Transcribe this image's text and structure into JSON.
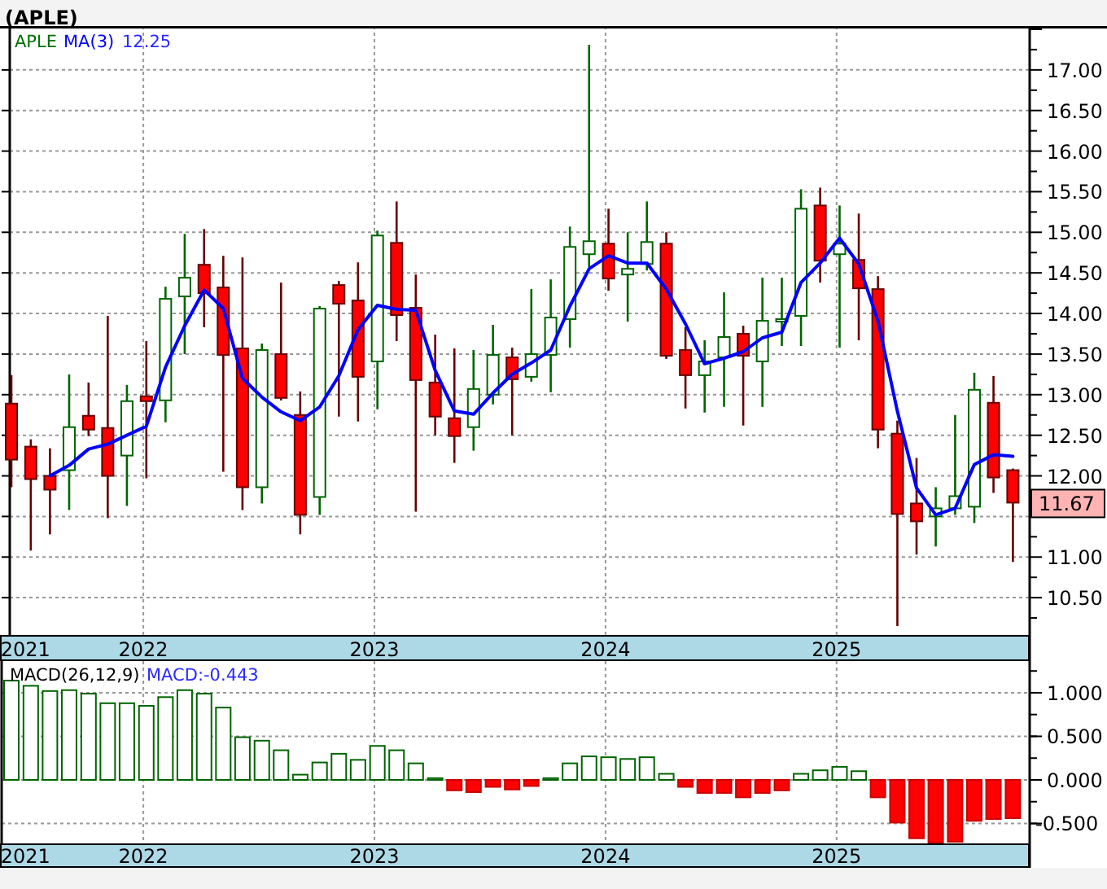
{
  "title": "(APLE)",
  "price_panel": {
    "symbol": "APLE",
    "ma_value": "12.25",
    "last_price_tag": "11.67",
    "chart_data": {
      "type": "candlestick",
      "grid": true,
      "ylim": [
        10.04,
        17.54
      ],
      "xlim": [
        2021.422,
        2025.832
      ],
      "x": [
        2021.429,
        2021.513,
        2021.596,
        2021.679,
        2021.763,
        2021.846,
        2021.929,
        2022.013,
        2022.096,
        2022.179,
        2022.263,
        2022.346,
        2022.429,
        2022.513,
        2022.596,
        2022.679,
        2022.763,
        2022.846,
        2022.929,
        2023.013,
        2023.096,
        2023.179,
        2023.263,
        2023.346,
        2023.429,
        2023.513,
        2023.596,
        2023.679,
        2023.763,
        2023.846,
        2023.929,
        2024.013,
        2024.096,
        2024.179,
        2024.263,
        2024.346,
        2024.429,
        2024.513,
        2024.596,
        2024.679,
        2024.763,
        2024.846,
        2024.929,
        2025.013,
        2025.096,
        2025.179,
        2025.263,
        2025.346,
        2025.429,
        2025.513,
        2025.596,
        2025.679,
        2025.763
      ],
      "yticks": [
        {
          "value": 17,
          "label": "17.00"
        },
        {
          "value": 16.5,
          "label": "16.50"
        },
        {
          "value": 16,
          "label": "16.00"
        },
        {
          "value": 15.5,
          "label": "15.50"
        },
        {
          "value": 15,
          "label": "15.00"
        },
        {
          "value": 14.5,
          "label": "14.50"
        },
        {
          "value": 14,
          "label": "14.00"
        },
        {
          "value": 13.5,
          "label": "13.50"
        },
        {
          "value": 13,
          "label": "13.00"
        },
        {
          "value": 12.5,
          "label": "12.50"
        },
        {
          "value": 12,
          "label": "12.00"
        },
        {
          "value": 11,
          "label": "11.00"
        },
        {
          "value": 10.5,
          "label": "10.50"
        }
      ],
      "xticks": [
        {
          "value": 2021.49,
          "label": "2021"
        },
        2022,
        2023,
        2024,
        2025
      ],
      "series": [
        {
          "name": "MA(3)",
          "type": "line",
          "color": "#0000ff",
          "values": [
            null,
            null,
            12.0,
            12.13,
            12.33,
            12.39,
            12.5,
            12.61,
            13.34,
            13.85,
            14.29,
            14.06,
            13.2,
            12.97,
            12.79,
            12.68,
            12.85,
            13.23,
            13.8,
            14.1,
            14.05,
            14.04,
            13.3,
            12.8,
            12.76,
            13.02,
            13.25,
            13.39,
            13.55,
            14.09,
            14.55,
            14.71,
            14.62,
            14.62,
            14.3,
            13.87,
            13.38,
            13.45,
            13.53,
            13.7,
            13.77,
            14.38,
            14.62,
            14.93,
            14.61,
            13.91,
            12.8,
            11.85,
            11.52,
            11.6,
            12.14,
            12.26,
            12.24
          ]
        }
      ],
      "ohlc": [
        [
          12.89,
          13.24,
          11.86,
          12.2
        ],
        [
          12.36,
          12.45,
          11.08,
          11.96
        ],
        [
          12.0,
          12.34,
          11.28,
          11.83
        ],
        [
          12.07,
          13.25,
          11.58,
          12.6
        ],
        [
          12.74,
          13.15,
          12.49,
          12.57
        ],
        [
          12.59,
          13.97,
          11.48,
          12.0
        ],
        [
          12.25,
          13.12,
          11.63,
          12.92
        ],
        [
          12.98,
          13.66,
          11.97,
          12.92
        ],
        [
          12.93,
          14.33,
          12.66,
          14.18
        ],
        [
          14.21,
          14.98,
          13.5,
          14.44
        ],
        [
          14.6,
          15.04,
          13.83,
          14.25
        ],
        [
          14.32,
          14.71,
          12.05,
          13.49
        ],
        [
          13.57,
          14.69,
          11.58,
          11.86
        ],
        [
          11.86,
          13.63,
          11.66,
          13.55
        ],
        [
          13.5,
          14.38,
          12.93,
          12.96
        ],
        [
          12.75,
          13.04,
          11.28,
          11.52
        ],
        [
          11.74,
          14.09,
          11.52,
          14.06
        ],
        [
          14.35,
          14.4,
          12.73,
          14.12
        ],
        [
          14.16,
          14.63,
          12.67,
          13.22
        ],
        [
          13.41,
          15.02,
          12.82,
          14.96
        ],
        [
          14.87,
          15.38,
          13.66,
          13.98
        ],
        [
          14.07,
          14.48,
          11.56,
          13.18
        ],
        [
          13.15,
          13.74,
          12.5,
          12.73
        ],
        [
          12.71,
          13.57,
          12.16,
          12.49
        ],
        [
          12.6,
          13.55,
          12.31,
          13.07
        ],
        [
          13.0,
          13.86,
          12.88,
          13.49
        ],
        [
          13.46,
          13.58,
          12.5,
          13.19
        ],
        [
          13.22,
          14.3,
          13.16,
          13.5
        ],
        [
          13.49,
          14.42,
          13.03,
          13.95
        ],
        [
          13.93,
          15.07,
          13.58,
          14.82
        ],
        [
          14.73,
          17.31,
          14.57,
          14.89
        ],
        [
          14.86,
          15.29,
          14.28,
          14.43
        ],
        [
          14.48,
          15.0,
          13.9,
          14.55
        ],
        [
          14.61,
          15.38,
          14.53,
          14.88
        ],
        [
          14.86,
          15.0,
          13.44,
          13.48
        ],
        [
          13.55,
          13.83,
          12.83,
          13.24
        ],
        [
          13.24,
          13.67,
          12.78,
          13.41
        ],
        [
          13.46,
          14.26,
          12.85,
          13.71
        ],
        [
          13.75,
          13.85,
          12.62,
          13.48
        ],
        [
          13.41,
          14.44,
          12.85,
          13.91
        ],
        [
          13.9,
          14.44,
          13.6,
          13.93
        ],
        [
          13.97,
          15.53,
          13.6,
          15.29
        ],
        [
          15.33,
          15.55,
          14.38,
          14.65
        ],
        [
          14.73,
          15.33,
          13.58,
          14.86
        ],
        [
          14.66,
          15.23,
          13.67,
          14.31
        ],
        [
          14.3,
          14.46,
          12.34,
          12.57
        ],
        [
          12.52,
          12.68,
          10.15,
          11.53
        ],
        [
          11.66,
          12.22,
          11.03,
          11.44
        ],
        [
          11.5,
          11.86,
          11.13,
          11.6
        ],
        [
          11.6,
          12.75,
          11.52,
          11.75
        ],
        [
          11.62,
          13.27,
          11.42,
          13.06
        ],
        [
          12.9,
          13.23,
          11.79,
          11.98
        ],
        [
          12.07,
          12.09,
          10.94,
          11.67
        ]
      ]
    }
  },
  "macd_panel": {
    "legend": [
      {
        "kind": "label",
        "text": "MACD(26,12,9)"
      },
      {
        "kind": "value",
        "text": "MACD:-0.443"
      }
    ],
    "chart_data": {
      "type": "bar",
      "grid": true,
      "ylim": [
        -0.729,
        1.364
      ],
      "xlim": [
        2021.422,
        2025.832
      ],
      "x": [
        2021.429,
        2021.513,
        2021.596,
        2021.679,
        2021.763,
        2021.846,
        2021.929,
        2022.013,
        2022.096,
        2022.179,
        2022.263,
        2022.346,
        2022.429,
        2022.513,
        2022.596,
        2022.679,
        2022.763,
        2022.846,
        2022.929,
        2023.013,
        2023.096,
        2023.179,
        2023.263,
        2023.346,
        2023.429,
        2023.513,
        2023.596,
        2023.679,
        2023.763,
        2023.846,
        2023.929,
        2024.013,
        2024.096,
        2024.179,
        2024.263,
        2024.346,
        2024.429,
        2024.513,
        2024.596,
        2024.679,
        2024.763,
        2024.846,
        2024.929,
        2025.013,
        2025.096,
        2025.179,
        2025.263,
        2025.346,
        2025.429,
        2025.513,
        2025.596,
        2025.679,
        2025.763
      ],
      "yticks": [
        {
          "value": 1,
          "label": "1.000"
        },
        {
          "value": 0.5,
          "label": "0.500"
        },
        {
          "value": 0,
          "label": "0.000"
        },
        {
          "value": -0.5,
          "label": "-0.500"
        }
      ],
      "xticks": [
        {
          "value": 2021.49,
          "label": "2021"
        },
        2022,
        2023,
        2024,
        2025
      ],
      "values": [
        1.14,
        1.08,
        1.02,
        1.03,
        0.99,
        0.88,
        0.88,
        0.85,
        0.95,
        1.03,
        0.99,
        0.83,
        0.49,
        0.45,
        0.34,
        0.06,
        0.2,
        0.3,
        0.23,
        0.39,
        0.34,
        0.19,
        0.02,
        -0.12,
        -0.14,
        -0.08,
        -0.11,
        -0.07,
        0.02,
        0.19,
        0.27,
        0.26,
        0.24,
        0.26,
        0.07,
        -0.08,
        -0.15,
        -0.15,
        -0.2,
        -0.15,
        -0.12,
        0.07,
        0.11,
        0.15,
        0.1,
        -0.2,
        -0.49,
        -0.67,
        -0.72,
        -0.71,
        -0.47,
        -0.45,
        -0.44
      ]
    }
  }
}
